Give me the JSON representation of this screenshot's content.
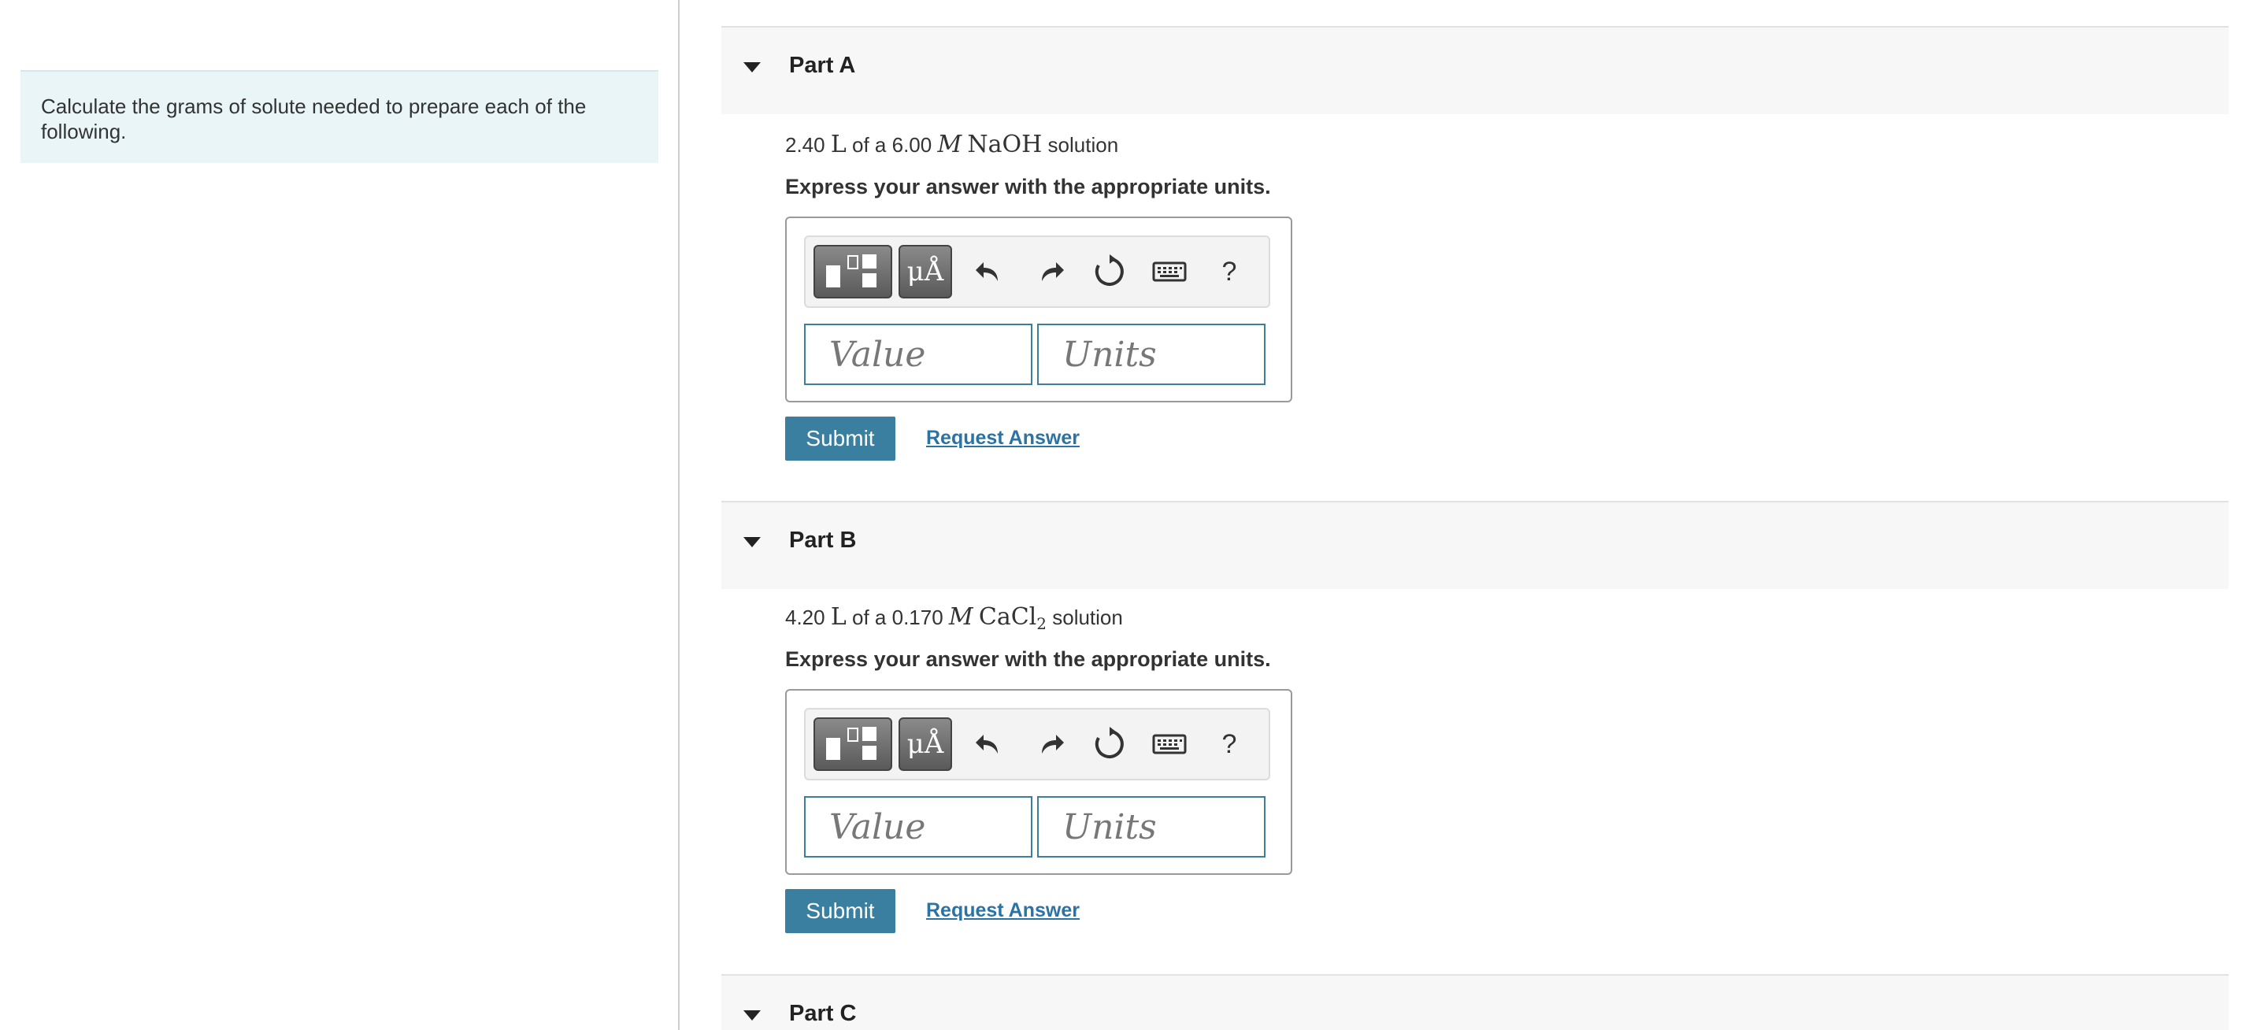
{
  "intro": {
    "text": "Calculate the grams of solute needed to prepare each of the following."
  },
  "parts": [
    {
      "title": "Part A",
      "problem": {
        "amount": "2.40",
        "unit_L": "L",
        "of_a": "of a",
        "molarity": "6.00",
        "unit_M": "M",
        "compound": "NaOH",
        "compound_sub": "",
        "suffix": "solution"
      },
      "instruction": "Express your answer with the appropriate units.",
      "toolbar": {
        "units_symbol": "μÅ",
        "help": "?"
      },
      "value_placeholder": "Value",
      "units_placeholder": "Units",
      "submit_label": "Submit",
      "request_label": "Request Answer"
    },
    {
      "title": "Part B",
      "problem": {
        "amount": "4.20",
        "unit_L": "L",
        "of_a": "of a",
        "molarity": "0.170",
        "unit_M": "M",
        "compound": "CaCl",
        "compound_sub": "2",
        "suffix": "solution"
      },
      "instruction": "Express your answer with the appropriate units.",
      "toolbar": {
        "units_symbol": "μÅ",
        "help": "?"
      },
      "value_placeholder": "Value",
      "units_placeholder": "Units",
      "submit_label": "Submit",
      "request_label": "Request Answer"
    },
    {
      "title": "Part C"
    }
  ],
  "icons": [
    "templates-icon",
    "undo-icon",
    "redo-icon",
    "reset-icon",
    "keyboard-icon",
    "help-icon",
    "caret-down-icon"
  ],
  "colors": {
    "accent": "#3a7fa0",
    "link": "#2b72a5",
    "intro_bg": "#e9f5f7",
    "header_bg": "#f7f7f7",
    "input_border": "#3d7e9a"
  }
}
